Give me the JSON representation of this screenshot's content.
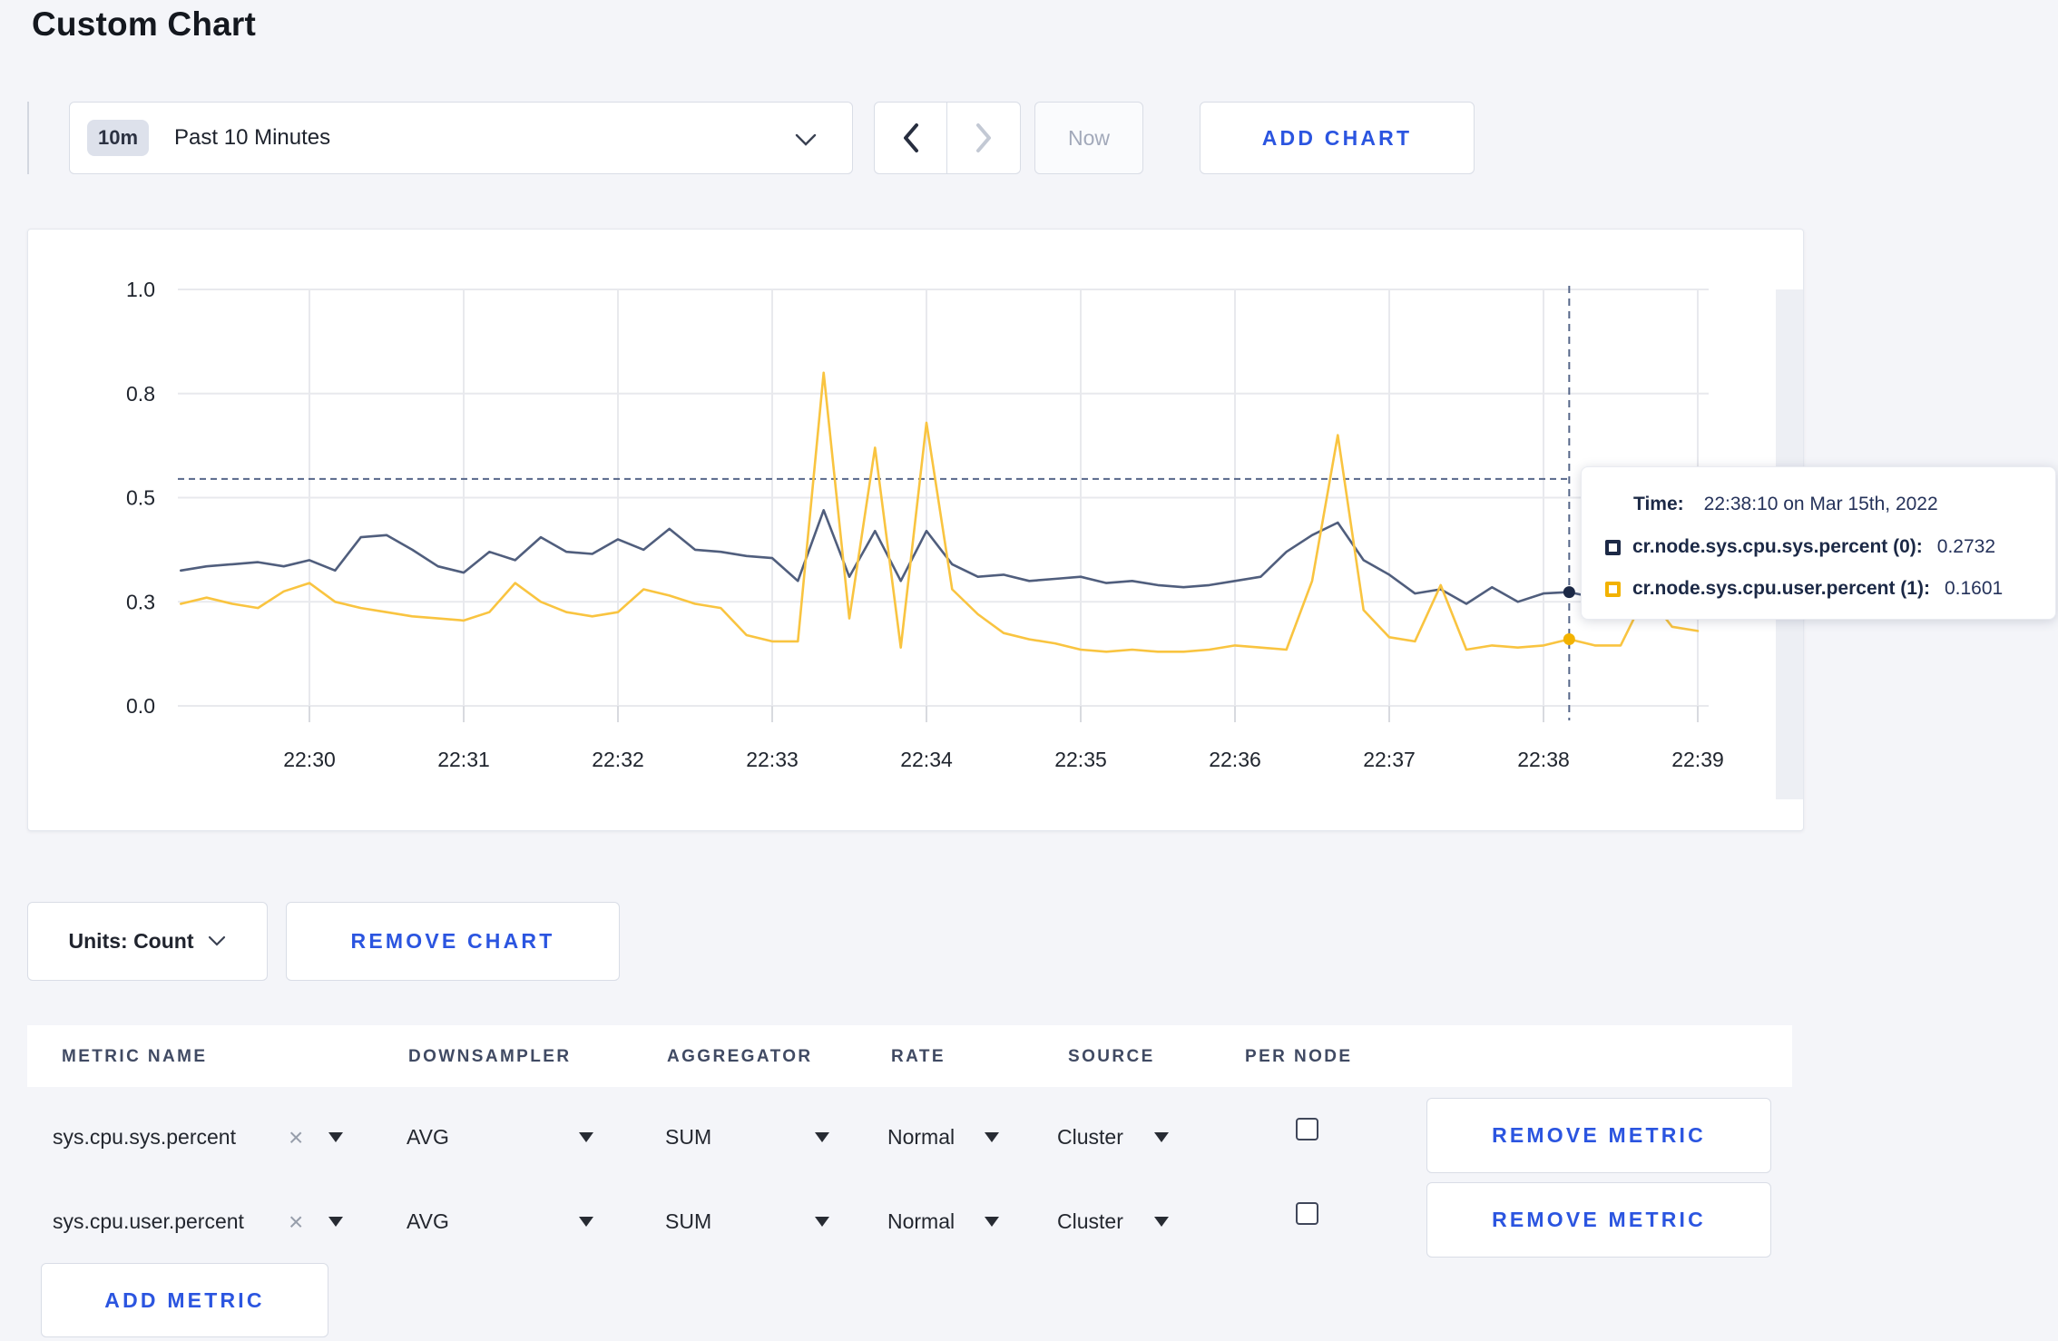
{
  "page": {
    "title": "Custom Chart",
    "background": "#f4f5f9",
    "accent_blue": "#2b55e0"
  },
  "toolbar": {
    "time_badge": "10m",
    "time_label": "Past 10 Minutes",
    "prev": "‹",
    "next": "›",
    "now_label": "Now",
    "add_chart_label": "ADD CHART"
  },
  "chart_controls": {
    "units_label": "Units: Count",
    "remove_chart_label": "REMOVE CHART"
  },
  "chart_data": {
    "type": "line",
    "title": "",
    "xlabel": "",
    "ylabel": "",
    "ylim": [
      0,
      1
    ],
    "grid": true,
    "x_ticks": [
      "22:30",
      "22:31",
      "22:32",
      "22:33",
      "22:34",
      "22:35",
      "22:36",
      "22:37",
      "22:38",
      "22:39"
    ],
    "y_ticks": {
      "values": [
        0,
        0.25,
        0.5,
        0.75,
        1.0
      ],
      "labels": [
        "0.0",
        "0.3",
        "0.5",
        "0.8",
        "1.0"
      ]
    },
    "start_time": "22:29:10",
    "interval_seconds": 10,
    "series": [
      {
        "name": "cr.node.sys.cpu.sys.percent",
        "color": "#505e7d",
        "legend_color": "#1c2946",
        "values": [
          0.325,
          0.335,
          0.34,
          0.345,
          0.335,
          0.35,
          0.325,
          0.405,
          0.41,
          0.375,
          0.335,
          0.32,
          0.37,
          0.35,
          0.405,
          0.37,
          0.365,
          0.4,
          0.375,
          0.425,
          0.375,
          0.37,
          0.36,
          0.355,
          0.3,
          0.47,
          0.31,
          0.42,
          0.3,
          0.42,
          0.34,
          0.31,
          0.315,
          0.3,
          0.305,
          0.31,
          0.295,
          0.3,
          0.29,
          0.285,
          0.29,
          0.3,
          0.31,
          0.37,
          0.41,
          0.44,
          0.35,
          0.315,
          0.27,
          0.28,
          0.245,
          0.285,
          0.25,
          0.27,
          0.2732,
          0.26,
          0.28,
          0.3,
          0.285,
          0.27
        ]
      },
      {
        "name": "cr.node.sys.cpu.user.percent",
        "color": "#f9c440",
        "legend_color": "#f2b200",
        "values": [
          0.245,
          0.26,
          0.245,
          0.235,
          0.275,
          0.295,
          0.25,
          0.235,
          0.225,
          0.215,
          0.21,
          0.205,
          0.225,
          0.295,
          0.25,
          0.225,
          0.215,
          0.225,
          0.28,
          0.265,
          0.245,
          0.235,
          0.17,
          0.155,
          0.155,
          0.8,
          0.21,
          0.62,
          0.14,
          0.68,
          0.28,
          0.22,
          0.175,
          0.16,
          0.15,
          0.135,
          0.13,
          0.135,
          0.13,
          0.13,
          0.135,
          0.145,
          0.14,
          0.135,
          0.3,
          0.65,
          0.23,
          0.165,
          0.155,
          0.29,
          0.135,
          0.145,
          0.14,
          0.145,
          0.1601,
          0.145,
          0.145,
          0.27,
          0.19,
          0.18
        ]
      }
    ],
    "crosshair": {
      "time": "22:38:10",
      "hline_value": 0.545
    },
    "tooltip": {
      "time_label": "Time:",
      "time_value": "22:38:10 on Mar 15th, 2022",
      "rows": [
        {
          "label": "cr.node.sys.cpu.sys.percent (0):",
          "value": "0.2732",
          "color": "#1c2946"
        },
        {
          "label": "cr.node.sys.cpu.user.percent (1):",
          "value": "0.1601",
          "color": "#f2b200"
        }
      ]
    }
  },
  "metrics_table": {
    "headers": [
      "METRIC NAME",
      "DOWNSAMPLER",
      "AGGREGATOR",
      "RATE",
      "SOURCE",
      "PER NODE"
    ],
    "rows": [
      {
        "name": "sys.cpu.sys.percent",
        "downsampler": "AVG",
        "aggregator": "SUM",
        "rate": "Normal",
        "source": "Cluster",
        "per_node": false,
        "remove_label": "REMOVE METRIC"
      },
      {
        "name": "sys.cpu.user.percent",
        "downsampler": "AVG",
        "aggregator": "SUM",
        "rate": "Normal",
        "source": "Cluster",
        "per_node": false,
        "remove_label": "REMOVE METRIC"
      }
    ],
    "add_metric_label": "ADD METRIC"
  }
}
